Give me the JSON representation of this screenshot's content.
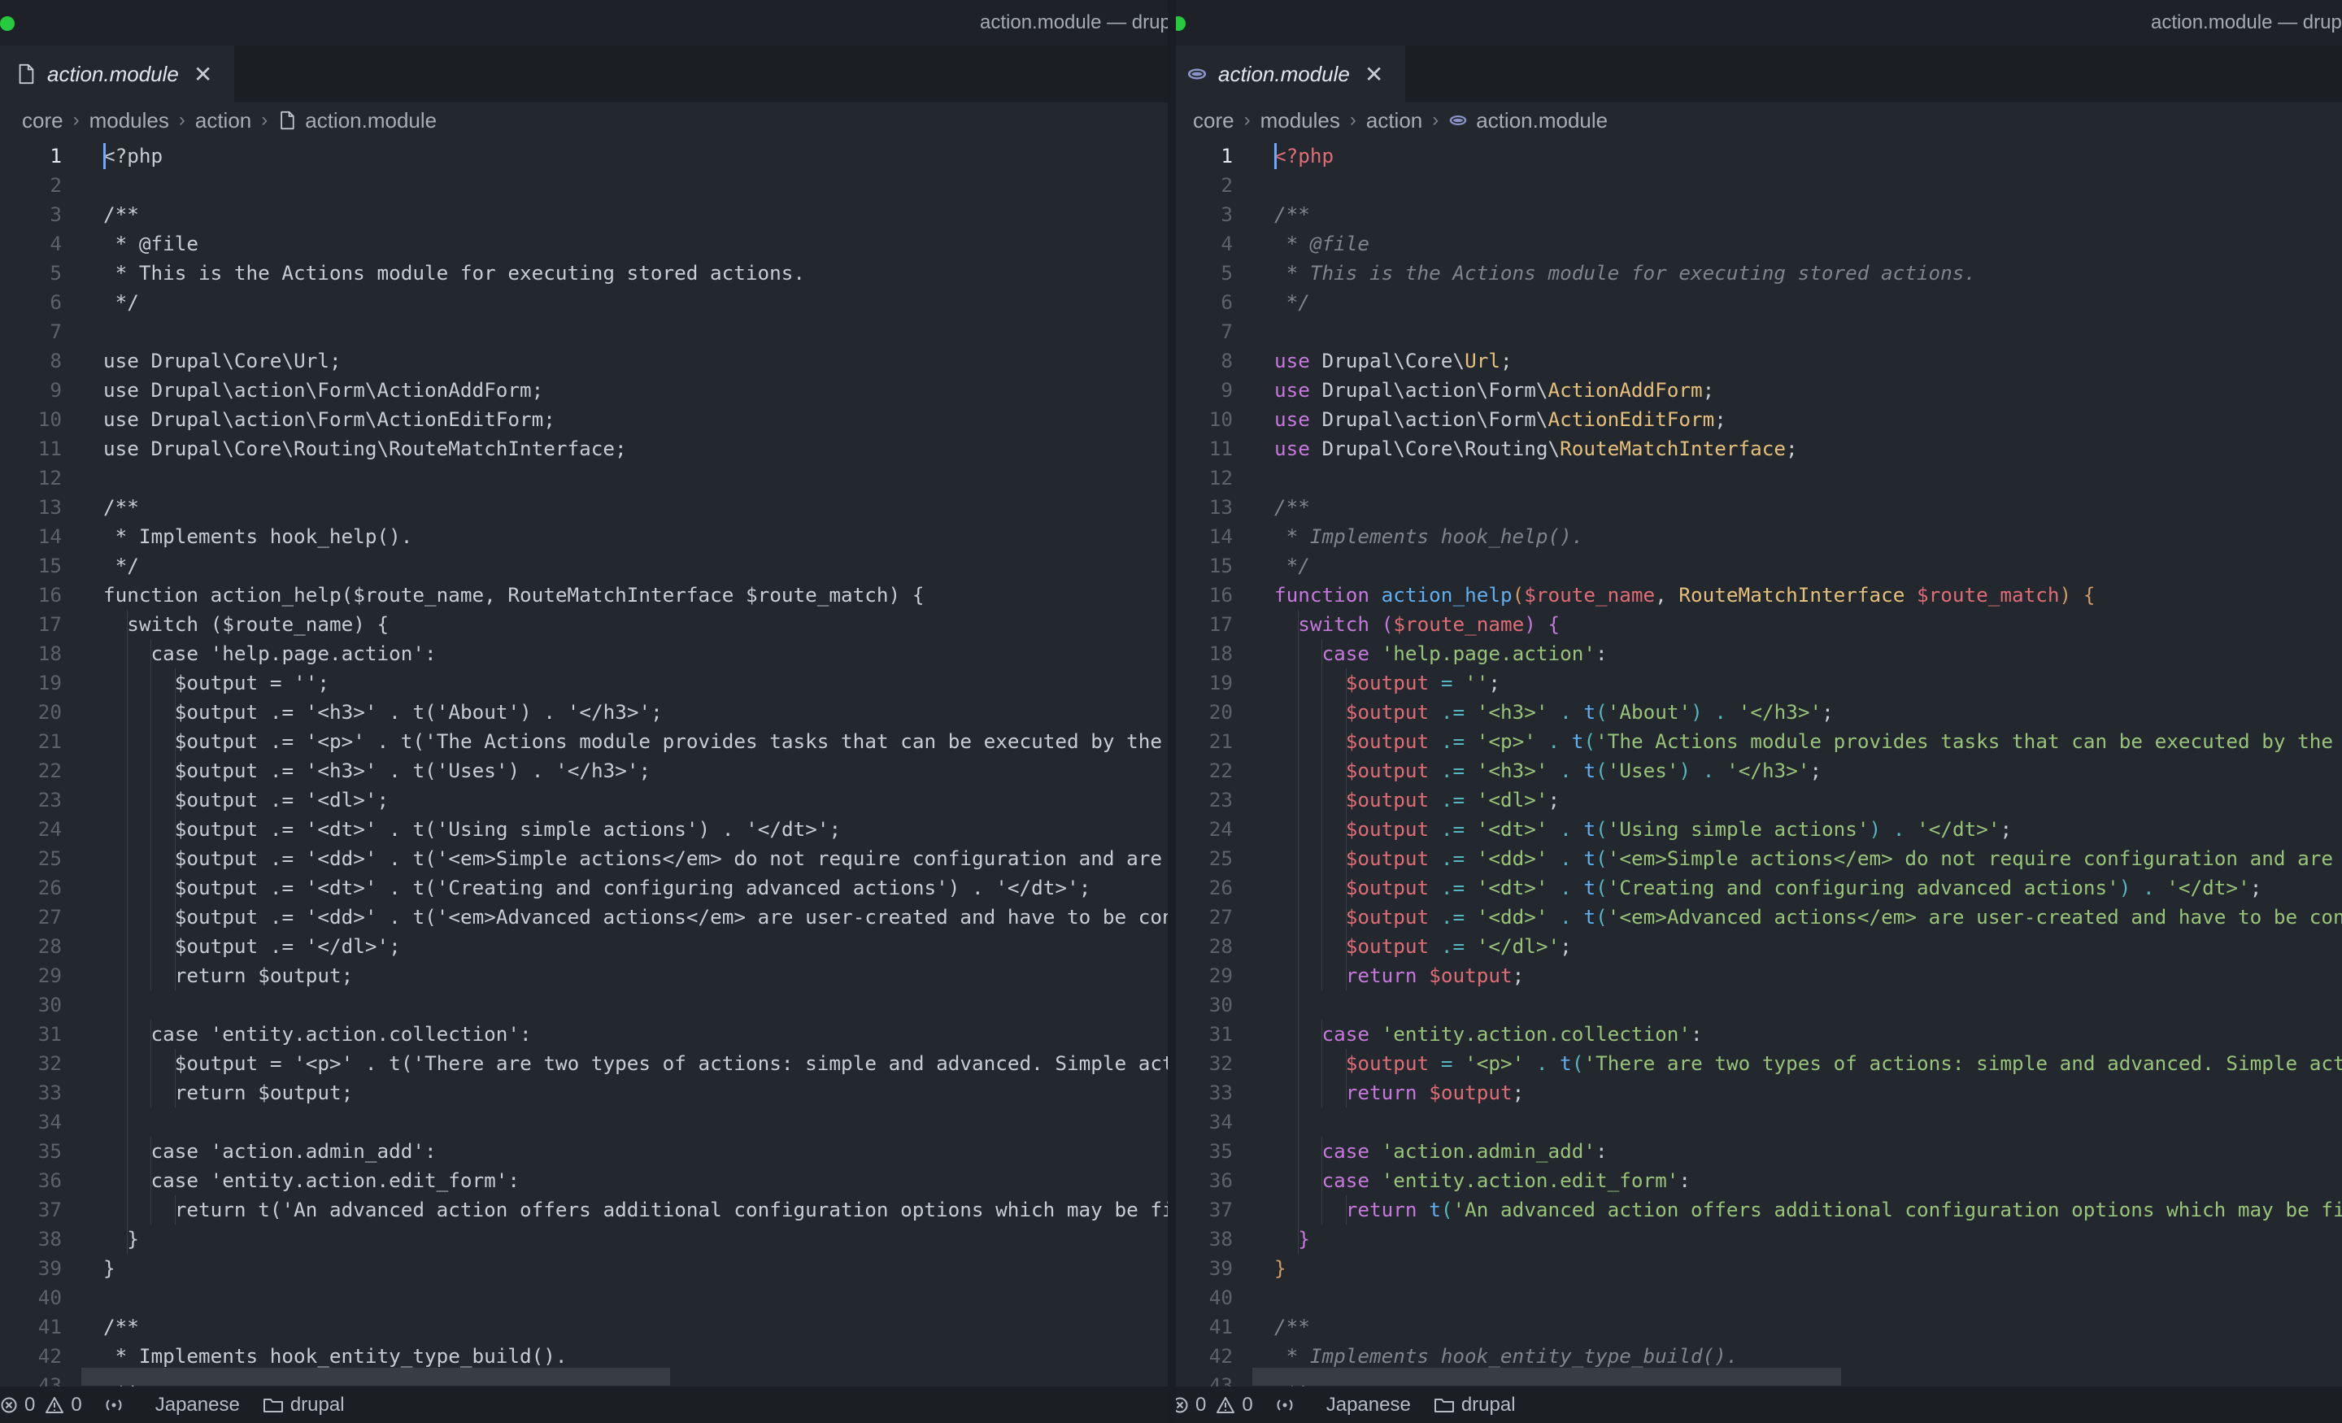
{
  "window": {
    "title": "action.module — drupal"
  },
  "tab": {
    "label": "action.module",
    "close_glyph": "✕"
  },
  "breadcrumb": [
    "core",
    "modules",
    "action",
    "action.module"
  ],
  "status": {
    "errors": "0",
    "warnings": "0",
    "language": "Japanese",
    "folder": "drupal"
  },
  "colors": {
    "background": "#23272e",
    "comment": "#7f848e",
    "keyword": "#c678dd",
    "type": "#e5c07b",
    "variable": "#e06c75",
    "string": "#98c379",
    "function": "#61afef",
    "operator": "#56b6c2",
    "bracket": "#d19a66"
  },
  "panes": [
    {
      "icon": "file-icon",
      "mode": "plain"
    },
    {
      "icon": "elephant-icon",
      "mode": "highlighted"
    }
  ],
  "code_lines": [
    [
      [
        "vr",
        "<?php"
      ]
    ],
    [],
    [
      [
        "cm",
        "/**"
      ]
    ],
    [
      [
        "cm",
        " * @file"
      ]
    ],
    [
      [
        "cm",
        " * This is the Actions module for executing stored actions."
      ]
    ],
    [
      [
        "cm",
        " */"
      ]
    ],
    [],
    [
      [
        "kw",
        "use"
      ],
      [
        "pl",
        " Drupal\\Core\\"
      ],
      [
        "ty",
        "Url"
      ],
      [
        "pl",
        ";"
      ]
    ],
    [
      [
        "kw",
        "use"
      ],
      [
        "pl",
        " Drupal\\action\\Form\\"
      ],
      [
        "ty",
        "ActionAddForm"
      ],
      [
        "pl",
        ";"
      ]
    ],
    [
      [
        "kw",
        "use"
      ],
      [
        "pl",
        " Drupal\\action\\Form\\"
      ],
      [
        "ty",
        "ActionEditForm"
      ],
      [
        "pl",
        ";"
      ]
    ],
    [
      [
        "kw",
        "use"
      ],
      [
        "pl",
        " Drupal\\Core\\Routing\\"
      ],
      [
        "ty",
        "RouteMatchInterface"
      ],
      [
        "pl",
        ";"
      ]
    ],
    [],
    [
      [
        "cm",
        "/**"
      ]
    ],
    [
      [
        "cm",
        " * Implements hook_help()."
      ]
    ],
    [
      [
        "cm",
        " */"
      ]
    ],
    [
      [
        "kw",
        "function"
      ],
      [
        "pl",
        " "
      ],
      [
        "fn",
        "action_help"
      ],
      [
        "br",
        "("
      ],
      [
        "vr",
        "$route_name"
      ],
      [
        "pl",
        ", "
      ],
      [
        "ty",
        "RouteMatchInterface"
      ],
      [
        "pl",
        " "
      ],
      [
        "vr",
        "$route_match"
      ],
      [
        "br",
        ")"
      ],
      [
        "pl",
        " "
      ],
      [
        "br",
        "{"
      ]
    ],
    [
      [
        "pl",
        "  "
      ],
      [
        "kw",
        "switch"
      ],
      [
        "pl",
        " "
      ],
      [
        "kw",
        "("
      ],
      [
        "vr",
        "$route_name"
      ],
      [
        "kw",
        ")"
      ],
      [
        "pl",
        " "
      ],
      [
        "kw",
        "{"
      ]
    ],
    [
      [
        "pl",
        "    "
      ],
      [
        "kw",
        "case"
      ],
      [
        "pl",
        " "
      ],
      [
        "st",
        "'help.page.action'"
      ],
      [
        "pl",
        ":"
      ]
    ],
    [
      [
        "pl",
        "      "
      ],
      [
        "vr",
        "$output"
      ],
      [
        "pl",
        " "
      ],
      [
        "op",
        "="
      ],
      [
        "pl",
        " "
      ],
      [
        "st",
        "''"
      ],
      [
        "pl",
        ";"
      ]
    ],
    [
      [
        "pl",
        "      "
      ],
      [
        "vr",
        "$output"
      ],
      [
        "pl",
        " "
      ],
      [
        "op",
        ".="
      ],
      [
        "pl",
        " "
      ],
      [
        "st",
        "'<h3>'"
      ],
      [
        "pl",
        " "
      ],
      [
        "op",
        "."
      ],
      [
        "pl",
        " "
      ],
      [
        "fn",
        "t"
      ],
      [
        "op",
        "("
      ],
      [
        "st",
        "'About'"
      ],
      [
        "op",
        ")"
      ],
      [
        "pl",
        " "
      ],
      [
        "op",
        "."
      ],
      [
        "pl",
        " "
      ],
      [
        "st",
        "'</h3>'"
      ],
      [
        "pl",
        ";"
      ]
    ],
    [
      [
        "pl",
        "      "
      ],
      [
        "vr",
        "$output"
      ],
      [
        "pl",
        " "
      ],
      [
        "op",
        ".="
      ],
      [
        "pl",
        " "
      ],
      [
        "st",
        "'<p>'"
      ],
      [
        "pl",
        " "
      ],
      [
        "op",
        "."
      ],
      [
        "pl",
        " "
      ],
      [
        "fn",
        "t"
      ],
      [
        "op",
        "("
      ],
      [
        "st",
        "'The Actions module provides tasks that can be executed by the site"
      ]
    ],
    [
      [
        "pl",
        "      "
      ],
      [
        "vr",
        "$output"
      ],
      [
        "pl",
        " "
      ],
      [
        "op",
        ".="
      ],
      [
        "pl",
        " "
      ],
      [
        "st",
        "'<h3>'"
      ],
      [
        "pl",
        " "
      ],
      [
        "op",
        "."
      ],
      [
        "pl",
        " "
      ],
      [
        "fn",
        "t"
      ],
      [
        "op",
        "("
      ],
      [
        "st",
        "'Uses'"
      ],
      [
        "op",
        ")"
      ],
      [
        "pl",
        " "
      ],
      [
        "op",
        "."
      ],
      [
        "pl",
        " "
      ],
      [
        "st",
        "'</h3>'"
      ],
      [
        "pl",
        ";"
      ]
    ],
    [
      [
        "pl",
        "      "
      ],
      [
        "vr",
        "$output"
      ],
      [
        "pl",
        " "
      ],
      [
        "op",
        ".="
      ],
      [
        "pl",
        " "
      ],
      [
        "st",
        "'<dl>'"
      ],
      [
        "pl",
        ";"
      ]
    ],
    [
      [
        "pl",
        "      "
      ],
      [
        "vr",
        "$output"
      ],
      [
        "pl",
        " "
      ],
      [
        "op",
        ".="
      ],
      [
        "pl",
        " "
      ],
      [
        "st",
        "'<dt>'"
      ],
      [
        "pl",
        " "
      ],
      [
        "op",
        "."
      ],
      [
        "pl",
        " "
      ],
      [
        "fn",
        "t"
      ],
      [
        "op",
        "("
      ],
      [
        "st",
        "'Using simple actions'"
      ],
      [
        "op",
        ")"
      ],
      [
        "pl",
        " "
      ],
      [
        "op",
        "."
      ],
      [
        "pl",
        " "
      ],
      [
        "st",
        "'</dt>'"
      ],
      [
        "pl",
        ";"
      ]
    ],
    [
      [
        "pl",
        "      "
      ],
      [
        "vr",
        "$output"
      ],
      [
        "pl",
        " "
      ],
      [
        "op",
        ".="
      ],
      [
        "pl",
        " "
      ],
      [
        "st",
        "'<dd>'"
      ],
      [
        "pl",
        " "
      ],
      [
        "op",
        "."
      ],
      [
        "pl",
        " "
      ],
      [
        "fn",
        "t"
      ],
      [
        "op",
        "("
      ],
      [
        "st",
        "'<em>Simple actions</em> do not require configuration and are liste"
      ]
    ],
    [
      [
        "pl",
        "      "
      ],
      [
        "vr",
        "$output"
      ],
      [
        "pl",
        " "
      ],
      [
        "op",
        ".="
      ],
      [
        "pl",
        " "
      ],
      [
        "st",
        "'<dt>'"
      ],
      [
        "pl",
        " "
      ],
      [
        "op",
        "."
      ],
      [
        "pl",
        " "
      ],
      [
        "fn",
        "t"
      ],
      [
        "op",
        "("
      ],
      [
        "st",
        "'Creating and configuring advanced actions'"
      ],
      [
        "op",
        ")"
      ],
      [
        "pl",
        " "
      ],
      [
        "op",
        "."
      ],
      [
        "pl",
        " "
      ],
      [
        "st",
        "'</dt>'"
      ],
      [
        "pl",
        ";"
      ]
    ],
    [
      [
        "pl",
        "      "
      ],
      [
        "vr",
        "$output"
      ],
      [
        "pl",
        " "
      ],
      [
        "op",
        ".="
      ],
      [
        "pl",
        " "
      ],
      [
        "st",
        "'<dd>'"
      ],
      [
        "pl",
        " "
      ],
      [
        "op",
        "."
      ],
      [
        "pl",
        " "
      ],
      [
        "fn",
        "t"
      ],
      [
        "op",
        "("
      ],
      [
        "st",
        "'<em>Advanced actions</em> are user-created and have to be configu"
      ]
    ],
    [
      [
        "pl",
        "      "
      ],
      [
        "vr",
        "$output"
      ],
      [
        "pl",
        " "
      ],
      [
        "op",
        ".="
      ],
      [
        "pl",
        " "
      ],
      [
        "st",
        "'</dl>'"
      ],
      [
        "pl",
        ";"
      ]
    ],
    [
      [
        "pl",
        "      "
      ],
      [
        "kw",
        "return"
      ],
      [
        "pl",
        " "
      ],
      [
        "vr",
        "$output"
      ],
      [
        "pl",
        ";"
      ]
    ],
    [],
    [
      [
        "pl",
        "    "
      ],
      [
        "kw",
        "case"
      ],
      [
        "pl",
        " "
      ],
      [
        "st",
        "'entity.action.collection'"
      ],
      [
        "pl",
        ":"
      ]
    ],
    [
      [
        "pl",
        "      "
      ],
      [
        "vr",
        "$output"
      ],
      [
        "pl",
        " "
      ],
      [
        "op",
        "="
      ],
      [
        "pl",
        " "
      ],
      [
        "st",
        "'<p>'"
      ],
      [
        "pl",
        " "
      ],
      [
        "op",
        "."
      ],
      [
        "pl",
        " "
      ],
      [
        "fn",
        "t"
      ],
      [
        "op",
        "("
      ],
      [
        "st",
        "'There are two types of actions: simple and advanced. Simple actio"
      ]
    ],
    [
      [
        "pl",
        "      "
      ],
      [
        "kw",
        "return"
      ],
      [
        "pl",
        " "
      ],
      [
        "vr",
        "$output"
      ],
      [
        "pl",
        ";"
      ]
    ],
    [],
    [
      [
        "pl",
        "    "
      ],
      [
        "kw",
        "case"
      ],
      [
        "pl",
        " "
      ],
      [
        "st",
        "'action.admin_add'"
      ],
      [
        "pl",
        ":"
      ]
    ],
    [
      [
        "pl",
        "    "
      ],
      [
        "kw",
        "case"
      ],
      [
        "pl",
        " "
      ],
      [
        "st",
        "'entity.action.edit_form'"
      ],
      [
        "pl",
        ":"
      ]
    ],
    [
      [
        "pl",
        "      "
      ],
      [
        "kw",
        "return"
      ],
      [
        "pl",
        " "
      ],
      [
        "fn",
        "t"
      ],
      [
        "op",
        "("
      ],
      [
        "st",
        "'An advanced action offers additional configuration options which may be fill"
      ]
    ],
    [
      [
        "pl",
        "  "
      ],
      [
        "kw",
        "}"
      ]
    ],
    [
      [
        "br",
        "}"
      ]
    ],
    [],
    [
      [
        "cm",
        "/**"
      ]
    ],
    [
      [
        "cm",
        " * Implements hook_entity_type_build()."
      ]
    ],
    [
      [
        "cm",
        " */"
      ]
    ]
  ]
}
